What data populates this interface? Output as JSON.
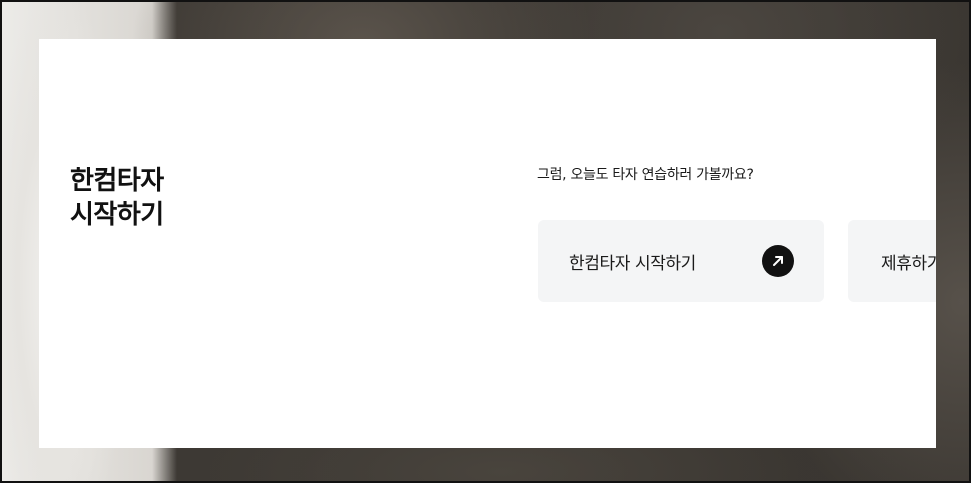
{
  "hero": {
    "title_line1": "한컴타자",
    "title_line2": "시작하기",
    "question": "그럼, 오늘도 타자 연습하러 가볼까요?"
  },
  "buttons": {
    "start_label": "한컴타자 시작하기",
    "partner_label": "제휴하기"
  },
  "icons": {
    "start_arrow": "arrow-up-right-icon"
  },
  "colors": {
    "card_bg": "#ffffff",
    "button_bg": "#f4f5f6",
    "arrow_circle": "#111111"
  }
}
